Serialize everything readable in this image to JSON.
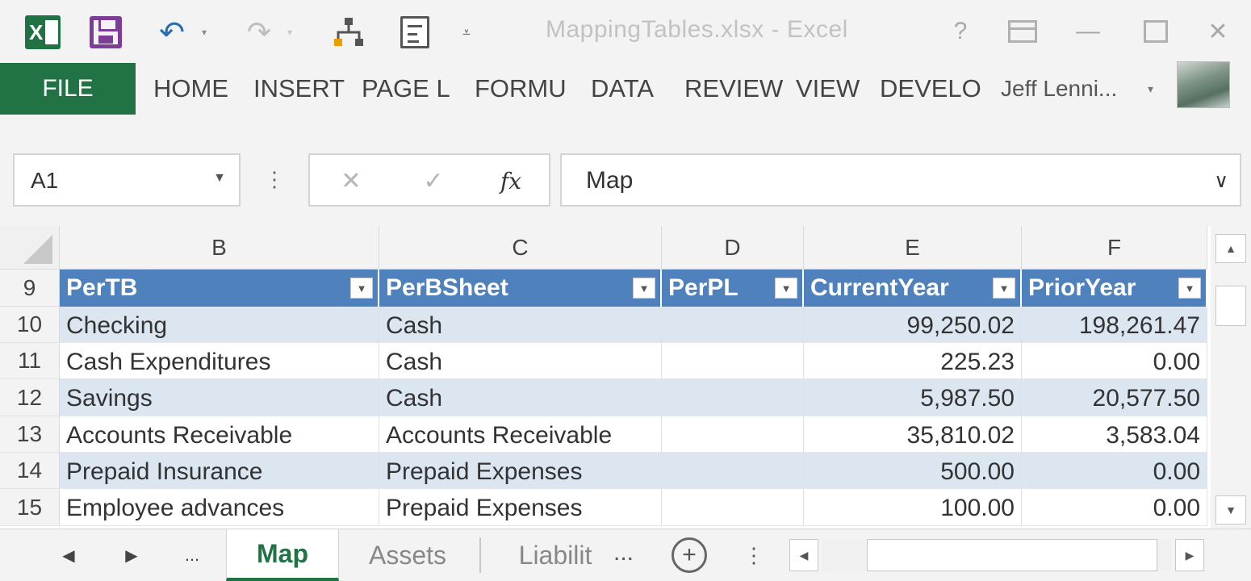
{
  "window": {
    "title": "MappingTables.xlsx - Excel",
    "help_glyph": "?",
    "minimize_glyph": "—",
    "close_glyph": "✕"
  },
  "quick_access": {
    "undo_glyph": "↶",
    "redo_glyph": "↷",
    "dropdown_glyph": "▾",
    "more_glyph": "⩡"
  },
  "ribbon": {
    "file_label": "FILE",
    "tabs": [
      "HOME",
      "INSERT",
      "PAGE L",
      "FORMU",
      "DATA",
      "REVIEW",
      "VIEW",
      "DEVELO"
    ],
    "user_name": "Jeff Lenni...",
    "user_caret": "▾"
  },
  "formula_bar": {
    "name_box": "A1",
    "name_box_caret": "▼",
    "dots": "⋮",
    "cancel_glyph": "✕",
    "enter_glyph": "✓",
    "fx_label": "fx",
    "content": "Map",
    "expand_glyph": "∨"
  },
  "grid": {
    "column_letters": [
      "B",
      "C",
      "D",
      "E",
      "F"
    ],
    "header_row_number": "9",
    "headers": [
      "PerTB",
      "PerBSheet",
      "PerPL",
      "CurrentYear",
      "PriorYear"
    ],
    "filter_glyph": "▼",
    "rows": [
      {
        "row": "10",
        "cells": [
          "Checking",
          "Cash",
          "",
          "99,250.02",
          "198,261.47"
        ]
      },
      {
        "row": "11",
        "cells": [
          "Cash Expenditures",
          "Cash",
          "",
          "225.23",
          "0.00"
        ]
      },
      {
        "row": "12",
        "cells": [
          "Savings",
          "Cash",
          "",
          "5,987.50",
          "20,577.50"
        ]
      },
      {
        "row": "13",
        "cells": [
          "Accounts Receivable",
          "Accounts Receivable",
          "",
          "35,810.02",
          "3,583.04"
        ]
      },
      {
        "row": "14",
        "cells": [
          "Prepaid Insurance",
          "Prepaid Expenses",
          "",
          "500.00",
          "0.00"
        ]
      },
      {
        "row": "15",
        "cells": [
          "Employee advances",
          "Prepaid Expenses",
          "",
          "100.00",
          "0.00"
        ]
      }
    ]
  },
  "scrollbars": {
    "up_glyph": "▲",
    "down_glyph": "▼",
    "left_glyph": "◀",
    "right_glyph": "▶"
  },
  "sheet_tabs": {
    "prev_glyph": "◀",
    "next_glyph": "▶",
    "more_glyph": "...",
    "tabs": [
      "Map",
      "Assets",
      "Liabilit"
    ],
    "overflow": "...",
    "add_glyph": "+",
    "dots": "⋮"
  },
  "colors": {
    "excel_green": "#217346",
    "table_header_blue": "#4f81bd",
    "band_blue": "#dce6f1"
  }
}
